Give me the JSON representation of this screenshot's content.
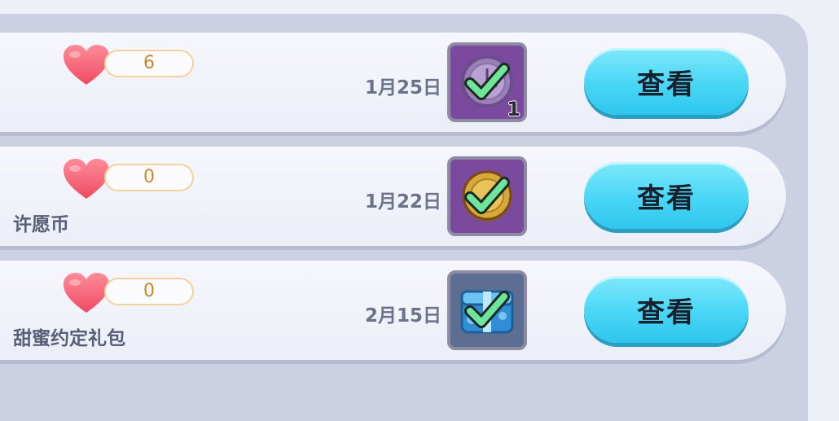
{
  "rows": [
    {
      "count": "6",
      "name": "",
      "date": "1月25日",
      "icon": "wish-coin-clock-icon",
      "icon_bg": "#7b4a9e",
      "badge": "1",
      "view_label": "查看"
    },
    {
      "count": "0",
      "name": "许愿币",
      "date": "1月22日",
      "icon": "gold-coin-icon",
      "icon_bg": "#7b4a9e",
      "badge": "",
      "view_label": "查看"
    },
    {
      "count": "0",
      "name": "甜蜜约定礼包",
      "date": "2月15日",
      "icon": "gift-chest-icon",
      "icon_bg": "#5c6f93",
      "badge": "",
      "view_label": "查看"
    }
  ],
  "colors": {
    "accent_button": "#48d6f6",
    "heart": "#f2566e",
    "check": "#6ee59a",
    "count_border": "#f0d39b"
  }
}
